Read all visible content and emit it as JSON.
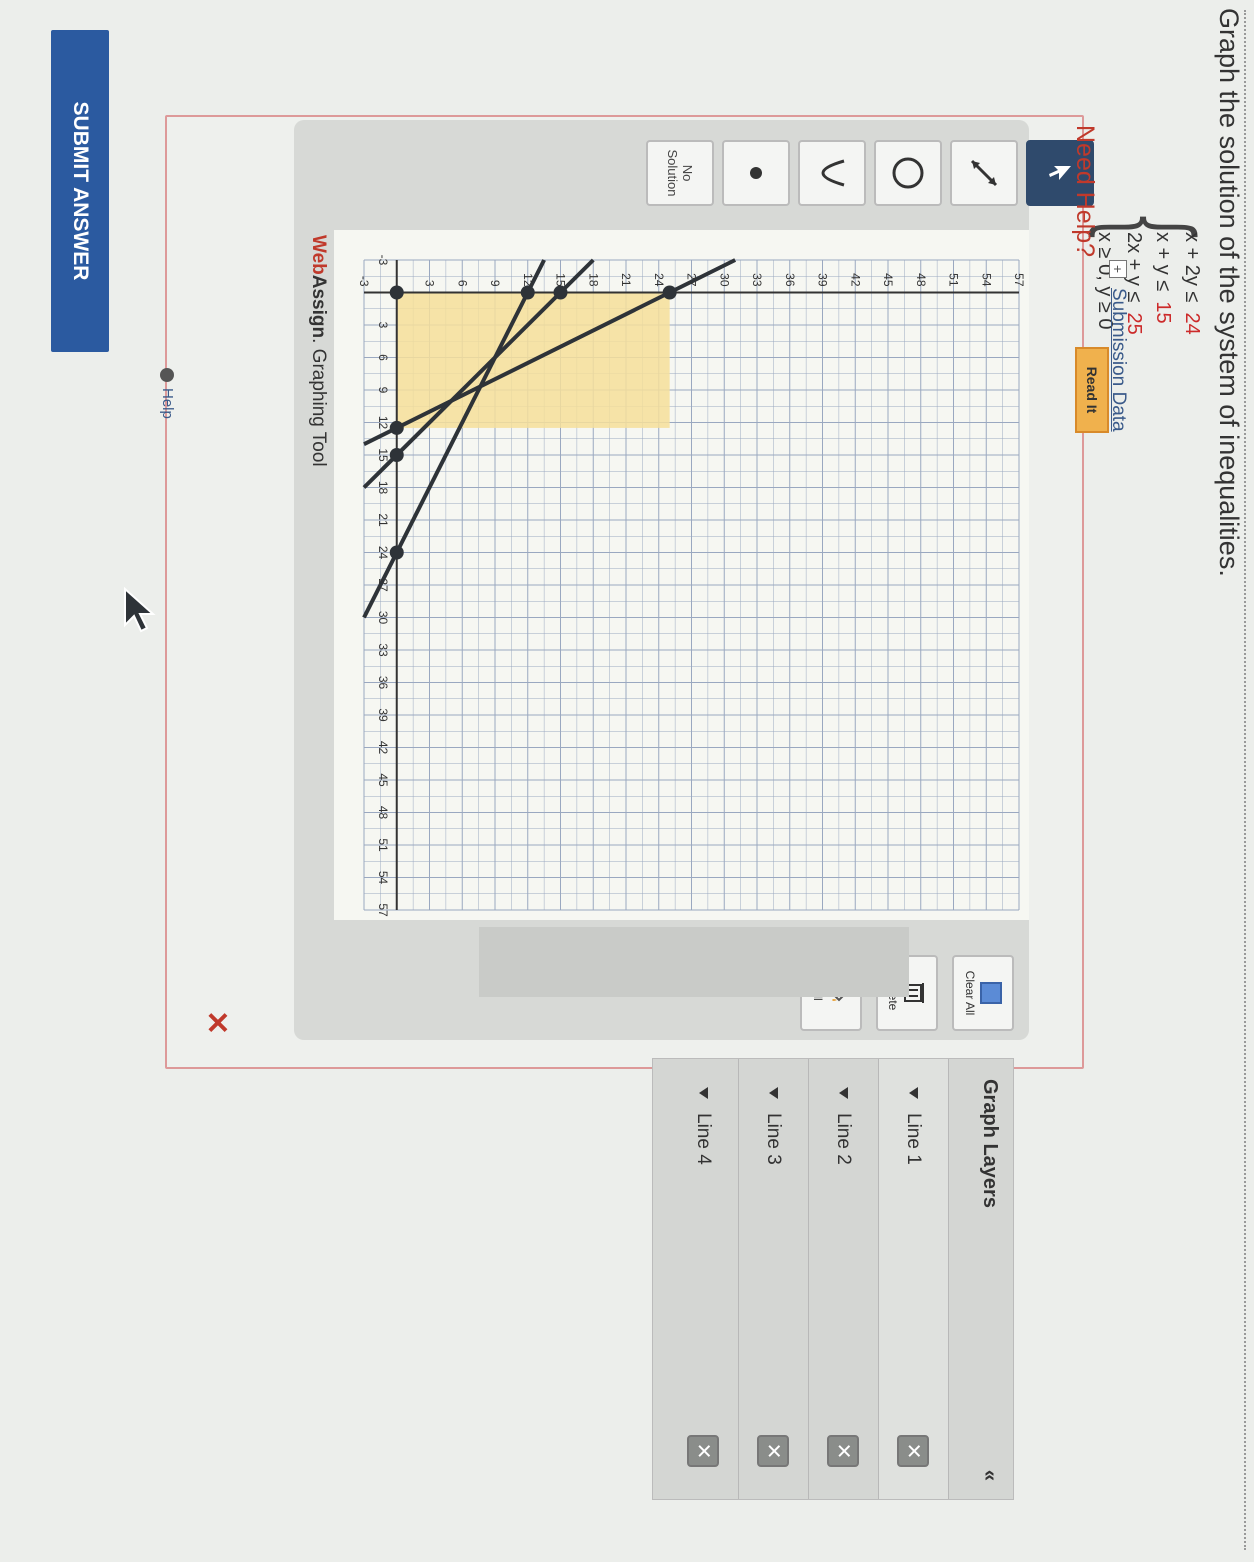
{
  "question": {
    "prompt": "Graph the solution of the system of inequalities.",
    "system": [
      {
        "lhs": "x + 2y ≤",
        "rhs": "24"
      },
      {
        "lhs": "x +   y ≤",
        "rhs": "15"
      },
      {
        "lhs": "2x +   y ≤",
        "rhs": "25"
      },
      {
        "lhs": "x ≥ 0, y ≥ 0",
        "rhs": ""
      }
    ]
  },
  "tools": {
    "no_solution_label": "No Solution",
    "help_label": "Help",
    "clear_all_label": "Clear All",
    "delete_label": "Delete",
    "fill_label": "Fill"
  },
  "footer": {
    "brand_web": "Web",
    "brand_assign": "Assign",
    "brand_tail": ". Graphing Tool"
  },
  "layers": {
    "title": "Graph Layers",
    "collapse": "«",
    "items": [
      {
        "label": "Line 1"
      },
      {
        "label": "Line 2"
      },
      {
        "label": "Line 3"
      },
      {
        "label": "Line 4"
      }
    ]
  },
  "submission": {
    "label": "Submission Data",
    "expand": "+"
  },
  "help": {
    "need_help": "Need Help?",
    "read_it": "Read It"
  },
  "submit_label": "SUBMIT ANSWER",
  "colors": {
    "shading": "#f6df9a",
    "line": "#2e3338",
    "accent_red": "#c0392b",
    "submit": "#2b5aa0"
  },
  "chart_data": {
    "type": "line",
    "x_ticks": [
      "-3",
      "3",
      "6",
      "9",
      "12",
      "15",
      "18",
      "21",
      "24",
      "27",
      "30",
      "33",
      "36",
      "39",
      "42",
      "45",
      "48",
      "51",
      "54",
      "57"
    ],
    "y_ticks": [
      "-3",
      "3",
      "6",
      "9",
      "12",
      "15",
      "18",
      "21",
      "24",
      "27",
      "30",
      "33",
      "36",
      "39",
      "42",
      "45",
      "48",
      "51",
      "54",
      "57"
    ],
    "xlim": [
      -3,
      57
    ],
    "ylim": [
      -3,
      57
    ],
    "series": [
      {
        "points": [
          [
            0,
            12
          ],
          [
            24,
            0
          ]
        ]
      },
      {
        "points": [
          [
            0,
            15
          ],
          [
            15,
            0
          ]
        ]
      },
      {
        "points": [
          [
            0,
            25
          ],
          [
            12.5,
            0
          ]
        ]
      }
    ],
    "point_markers": [
      [
        0,
        12
      ],
      [
        24,
        0
      ],
      [
        0,
        15
      ],
      [
        15,
        0
      ],
      [
        0,
        25
      ],
      [
        12.5,
        0
      ],
      [
        0,
        0
      ]
    ],
    "shaded_region": {
      "x": [
        0,
        12.5
      ],
      "y": [
        0,
        25
      ]
    },
    "grid": true
  }
}
